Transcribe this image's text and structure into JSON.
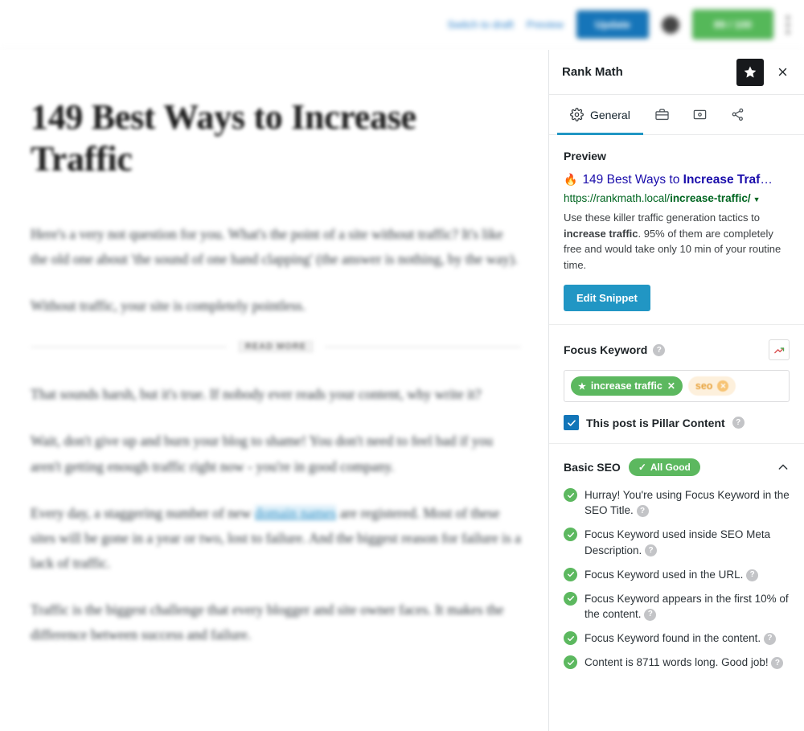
{
  "toolbar": {
    "switch_to_draft": "Switch to draft",
    "preview": "Preview",
    "update": "Update",
    "seo_score": "89 / 100",
    "menu_icon": "kebab-menu-icon"
  },
  "editor": {
    "post_title": "149 Best Ways to Increase Traffic",
    "paragraphs": [
      "Here's a very not question for you. What's the point of a site without traffic? It's like the old one about 'the sound of one hand clapping' (the answer is nothing, by the way).",
      "Without traffic, your site is completely pointless."
    ],
    "read_more_tag": "READ MORE",
    "paragraphs_after": [
      "That sounds harsh, but it's true. If nobody ever reads your content, why write it?",
      "Wait, don't give up and burn your blog to shame! You don't need to feel bad if you aren't getting enough traffic right now - you're in good company.",
      "Traffic is the biggest challenge that every blogger and site owner faces. It makes the difference between success and failure."
    ],
    "link_paragraph": {
      "before": "Every day, a staggering number of new ",
      "link": "domain names",
      "after": " are registered. Most of these sites will be gone in a year or two, lost to failure. And the biggest reason for failure is a lack of traffic."
    }
  },
  "panel": {
    "title": "Rank Math",
    "star_icon": "star-icon",
    "close_icon": "close-icon",
    "tabs": [
      {
        "label": "General",
        "icon": "gear-icon",
        "active": true
      },
      {
        "label": "",
        "icon": "briefcase-icon",
        "active": false
      },
      {
        "label": "",
        "icon": "schema-card-icon",
        "active": false
      },
      {
        "label": "",
        "icon": "social-share-icon",
        "active": false
      }
    ],
    "preview": {
      "heading": "Preview",
      "flame_icon": "flame-icon",
      "title_plain": "149 Best Ways to ",
      "title_bold": "Increase Traf",
      "title_ellipsis": "…",
      "url_base": "https://rankmath.local/",
      "url_slug": "increase-traffic/",
      "url_caret": "caret-down-icon",
      "description_part1": "Use these killer traffic generation tactics to ",
      "description_bold": "increase traffic",
      "description_part2": ". 95% of them are completely free and would take only 10 min of your routine time.",
      "edit_snippet_label": "Edit Snippet"
    },
    "focus_keyword": {
      "heading": "Focus Keyword",
      "help_icon": "help-icon",
      "trend_icon": "trending-up-icon",
      "chips": [
        {
          "label": "increase traffic",
          "primary": true,
          "star_icon": "star-icon",
          "remove_icon": "remove-icon"
        },
        {
          "label": "seo",
          "primary": false,
          "remove_icon": "remove-icon"
        }
      ],
      "pillar_label": "This post is Pillar Content",
      "pillar_checked": true,
      "pillar_help_icon": "help-icon",
      "checkbox_color": "#1275b8"
    },
    "basic_seo": {
      "heading": "Basic SEO",
      "badge_label": "All Good",
      "badge_check_icon": "check-icon",
      "badge_color": "#5cb85f",
      "collapse_icon": "chevron-up-icon",
      "items": [
        "Hurray! You're using Focus Keyword in the SEO Title.",
        "Focus Keyword used inside SEO Meta Description.",
        "Focus Keyword used in the URL.",
        "Focus Keyword appears in the first 10% of the content.",
        "Focus Keyword found in the content.",
        "Content is 8711 words long. Good job!"
      ]
    }
  }
}
